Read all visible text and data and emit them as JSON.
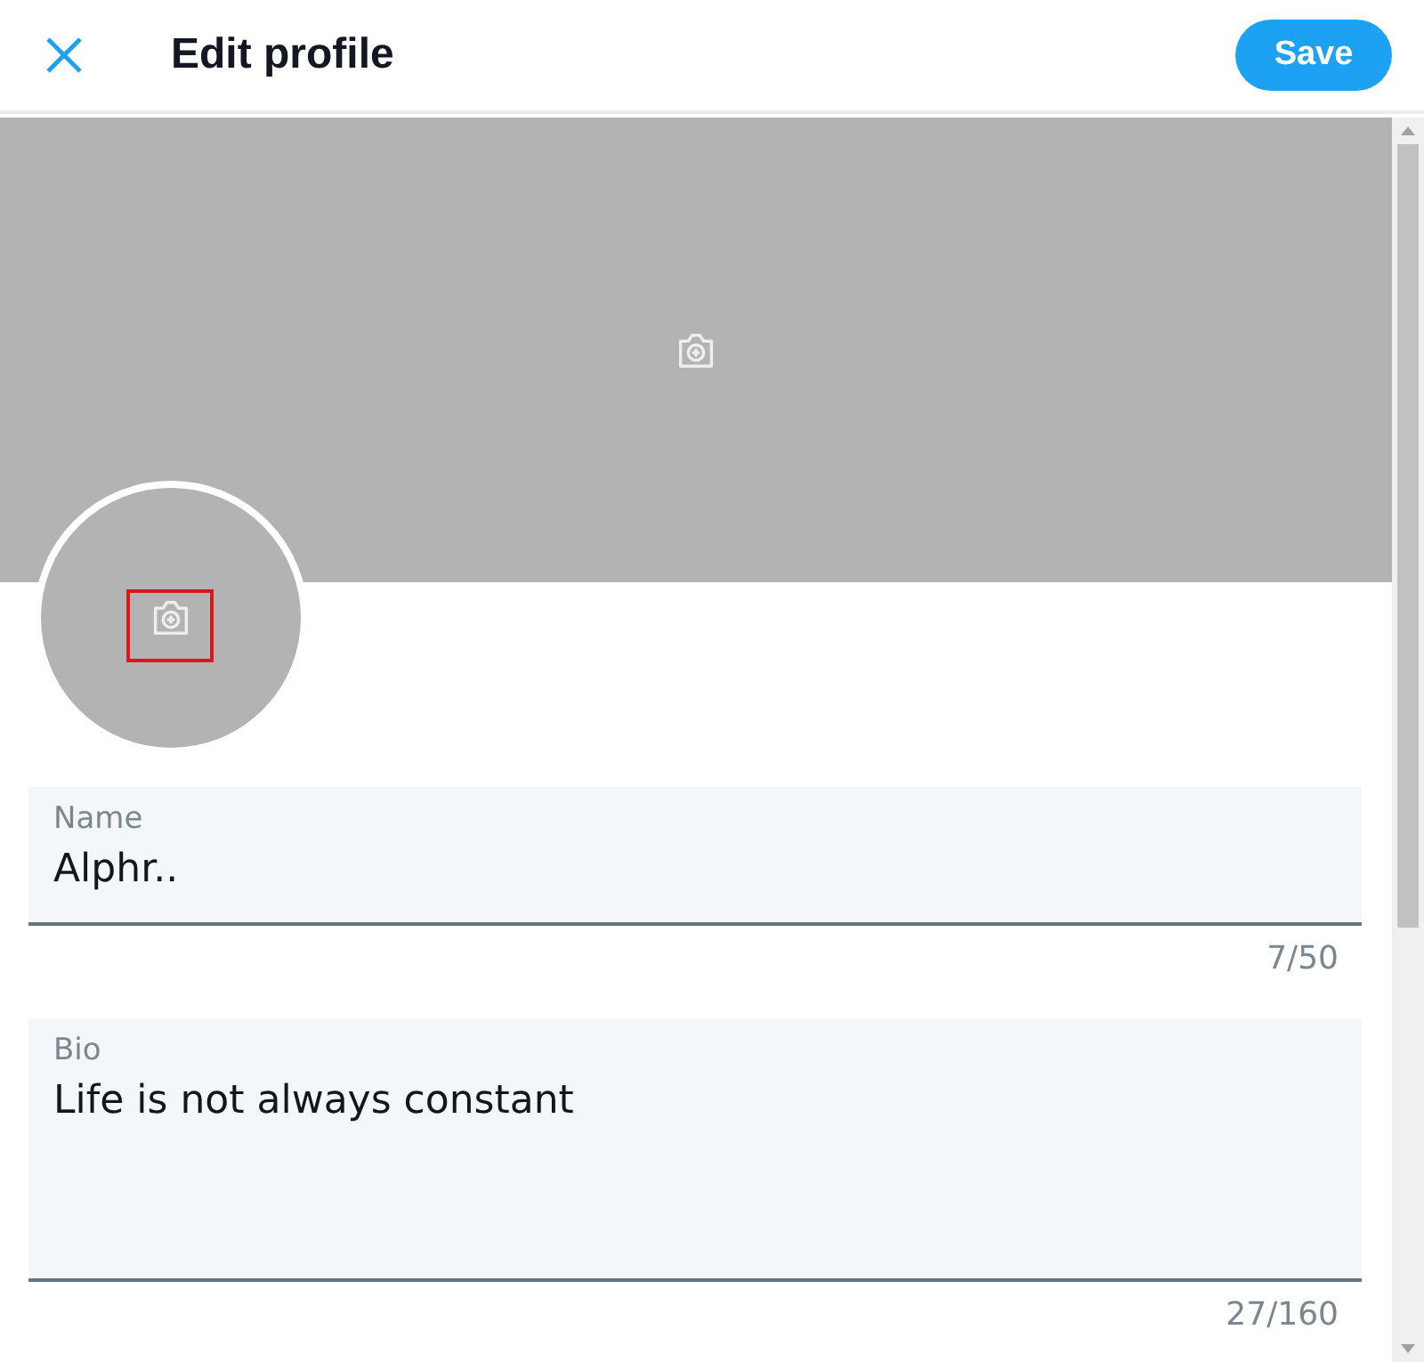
{
  "header": {
    "title": "Edit profile",
    "save_button": "Save"
  },
  "avatar": {
    "highlighted": true
  },
  "fields": [
    {
      "kind": "single",
      "label": "Name",
      "value": "Alphr..",
      "counter": "7/50"
    },
    {
      "kind": "multi",
      "label": "Bio",
      "value": "Life is not always constant",
      "counter": "27/160"
    }
  ]
}
